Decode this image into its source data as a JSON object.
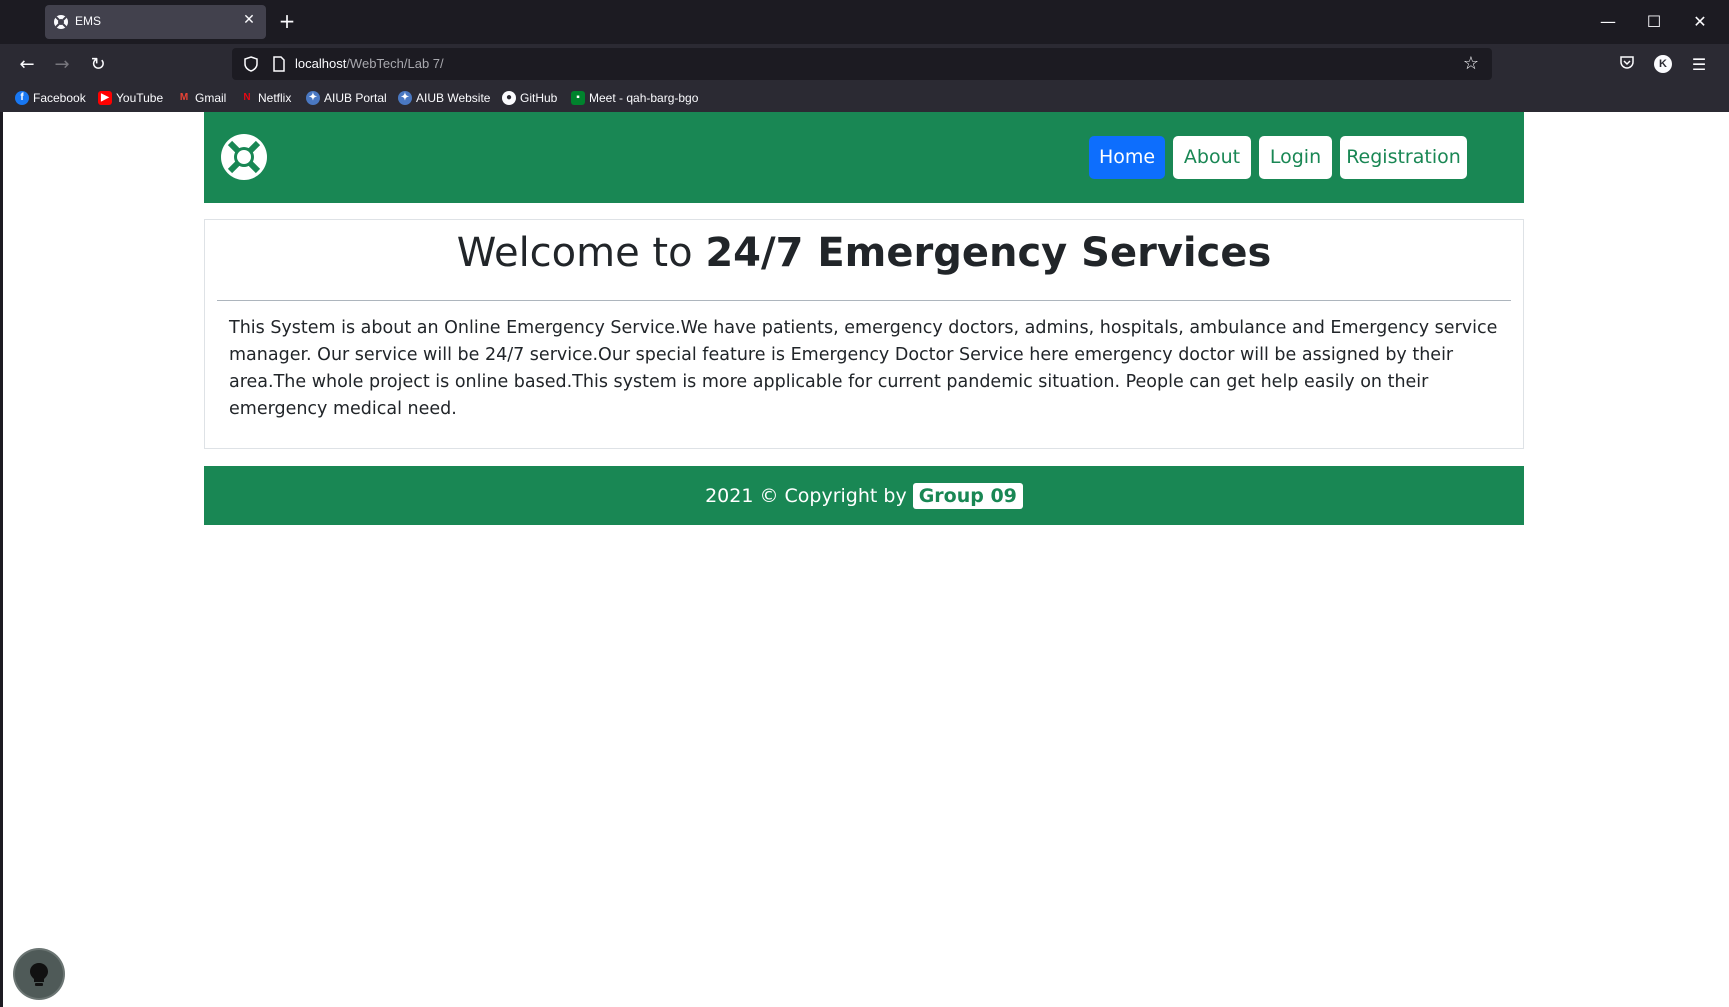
{
  "browser": {
    "tab_title": "EMS",
    "url_host": "localhost",
    "url_path": "/WebTech/Lab 7/",
    "profile_initial": "K",
    "bookmarks": [
      {
        "label": "Facebook",
        "icon": "facebook-icon",
        "color": "#1877f2"
      },
      {
        "label": "YouTube",
        "icon": "youtube-icon",
        "color": "#ff0000"
      },
      {
        "label": "Gmail",
        "icon": "gmail-icon",
        "color": "#ea4335"
      },
      {
        "label": "Netflix",
        "icon": "netflix-icon",
        "color": "#e50914"
      },
      {
        "label": "AIUB Portal",
        "icon": "aiub-icon",
        "color": "#4a78c2"
      },
      {
        "label": "AIUB Website",
        "icon": "aiub-icon",
        "color": "#4a78c2"
      },
      {
        "label": "GitHub",
        "icon": "github-icon",
        "color": "#ffffff"
      },
      {
        "label": "Meet - qah-barg-bgo",
        "icon": "meet-icon",
        "color": "#00832d"
      }
    ]
  },
  "site": {
    "nav": {
      "home": "Home",
      "about": "About",
      "login": "Login",
      "registration": "Registration"
    },
    "welcome_prefix": "Welcome to ",
    "welcome_strong": "24/7 Emergency Services",
    "description": "This System is about an Online Emergency Service.We have patients, emergency doctors, admins, hospitals, ambulance and Emergency service manager. Our service will be 24/7 service.Our special feature is Emergency Doctor Service here emergency doctor will be assigned by their area.The whole project is online based.This system is more applicable for current pandemic situation. People can get help easily on their emergency medical need.",
    "footer_text": "2021 © Copyright by",
    "footer_badge": "Group 09"
  },
  "colors": {
    "brand_green": "#198754",
    "primary_blue": "#0d6efd"
  }
}
